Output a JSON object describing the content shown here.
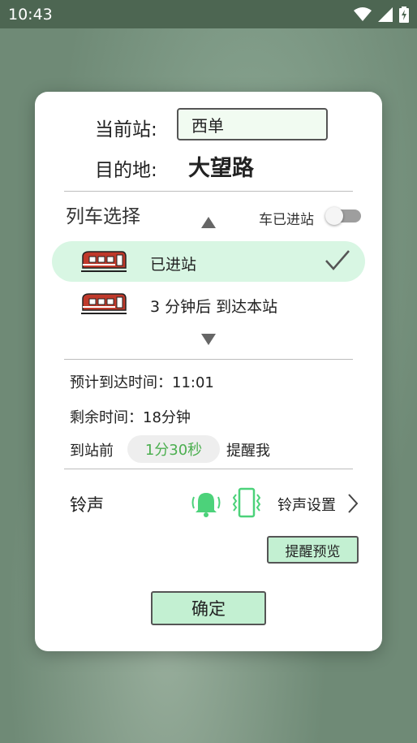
{
  "status_bar": {
    "time": "10:43"
  },
  "dialog": {
    "current_station_label": "当前站:",
    "current_station_value": "西单",
    "destination_label": "目的地:",
    "destination_value": "大望路",
    "train_section_title": "列车选择",
    "train_arrived_toggle_label": "车已进站",
    "train_arrived_toggle_on": false,
    "trains": [
      {
        "status": "已进站",
        "selected": true
      },
      {
        "status": "3 分钟后 到达本站",
        "selected": false
      }
    ],
    "eta_line": "预计到达时间：11:01",
    "remaining_line": "剩余时间：18分钟",
    "remind_prefix": "到站前",
    "remind_time": "1分30秒",
    "remind_suffix": "提醒我",
    "ringtone_label": "铃声",
    "ringtone_settings": "铃声设置",
    "preview_button": "提醒预览",
    "confirm_button": "确定"
  },
  "colors": {
    "accent_green": "#4caf50",
    "selected_row": "#d8f6e3",
    "button_fill": "#c3f0d2",
    "train_red": "#c0392b"
  },
  "icons": [
    "wifi-icon",
    "signal-icon",
    "battery-charging-icon",
    "train-icon",
    "check-icon",
    "bell-icon",
    "vibrate-icon",
    "chevron-right-icon"
  ]
}
